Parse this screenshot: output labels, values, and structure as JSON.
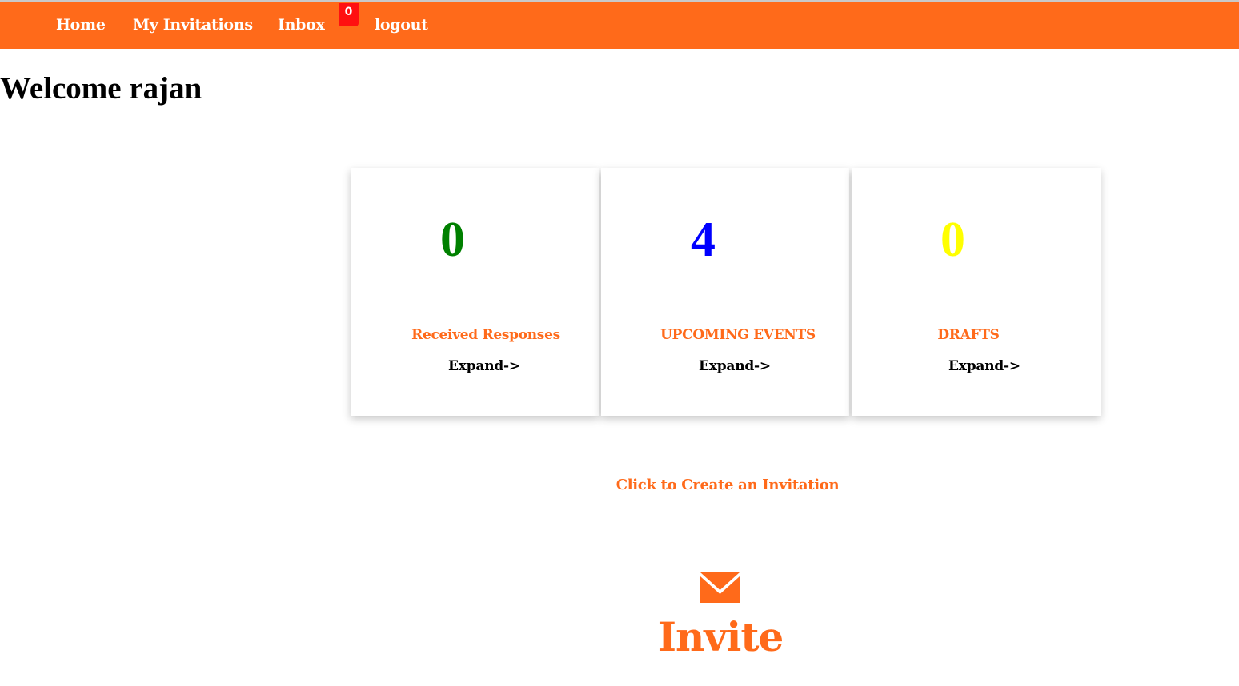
{
  "nav": {
    "home": "Home",
    "my_invitations": "My Invitations",
    "inbox": "Inbox",
    "inbox_badge": "0",
    "logout": "logout"
  },
  "welcome": "Welcome rajan",
  "cards": [
    {
      "count": "0",
      "title": "Received Responses",
      "expand": "Expand->",
      "count_color": "#008000"
    },
    {
      "count": "4",
      "title": "UPCOMING EVENTS",
      "expand": "Expand->",
      "count_color": "#0000ff"
    },
    {
      "count": "0",
      "title": "DRAFTS",
      "expand": "Expand->",
      "count_color": "#ffff00"
    }
  ],
  "create_link": "Click to Create an Invitation",
  "invite": {
    "icon": "envelope-icon",
    "label": "Invite"
  },
  "colors": {
    "brand": "#ff6a1a",
    "badge": "#ff1010"
  }
}
